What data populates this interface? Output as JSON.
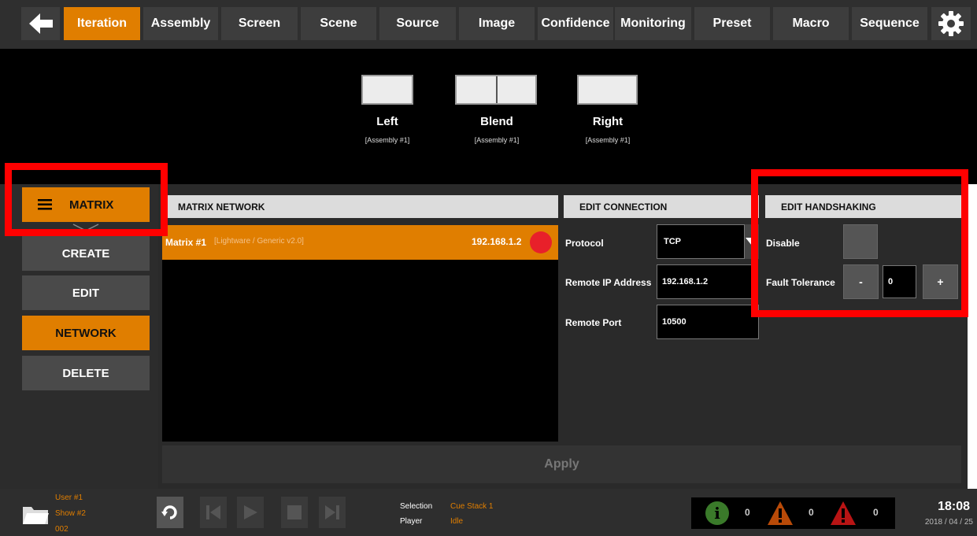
{
  "nav": {
    "back_icon": "back-arrow-icon",
    "tabs": [
      {
        "label": "Iteration",
        "active": true
      },
      {
        "label": "Assembly"
      },
      {
        "label": "Screen"
      },
      {
        "label": "Scene"
      },
      {
        "label": "Source"
      },
      {
        "label": "Image"
      },
      {
        "label": "Confidence"
      },
      {
        "label": "Monitoring"
      },
      {
        "label": "Preset"
      },
      {
        "label": "Macro"
      },
      {
        "label": "Sequence"
      }
    ],
    "settings_icon": "gear-icon"
  },
  "preview": {
    "items": [
      {
        "name": "Left",
        "sub": "[Assembly #1]"
      },
      {
        "name": "Blend",
        "sub": "[Assembly #1]"
      },
      {
        "name": "Right",
        "sub": "[Assembly #1]"
      }
    ]
  },
  "sidebar": {
    "menu_label": "MATRIX",
    "menu_icon": "hamburger-icon",
    "items": [
      {
        "label": "CREATE"
      },
      {
        "label": "EDIT"
      },
      {
        "label": "NETWORK",
        "active": true
      },
      {
        "label": "DELETE"
      }
    ]
  },
  "network": {
    "header": "MATRIX NETWORK",
    "rows": [
      {
        "name": "Matrix #1",
        "detail": "[Lightware / Generic v2.0]",
        "ip": "192.168.1.2",
        "status_color": "#e8202a"
      }
    ]
  },
  "connection": {
    "header": "EDIT CONNECTION",
    "protocol_label": "Protocol",
    "protocol_value": "TCP",
    "ip_label": "Remote IP Address",
    "ip_value": "192.168.1.2",
    "port_label": "Remote Port",
    "port_value": "10500"
  },
  "handshaking": {
    "header": "EDIT HANDSHAKING",
    "disable_label": "Disable",
    "fault_label": "Fault Tolerance",
    "minus": "-",
    "value": "0",
    "plus": "+"
  },
  "apply_label": "Apply",
  "status": {
    "user": "User #1",
    "show": "Show #2",
    "number": "002",
    "selection_label": "Selection",
    "selection_value": "Cue Stack 1",
    "player_label": "Player",
    "player_value": "Idle",
    "info_count": "0",
    "warning_count": "0",
    "error_count": "0",
    "time": "18:08",
    "date": "2018 / 04 / 25"
  },
  "colors": {
    "accent": "#e07e00",
    "highlight_box": "#ff0000"
  }
}
